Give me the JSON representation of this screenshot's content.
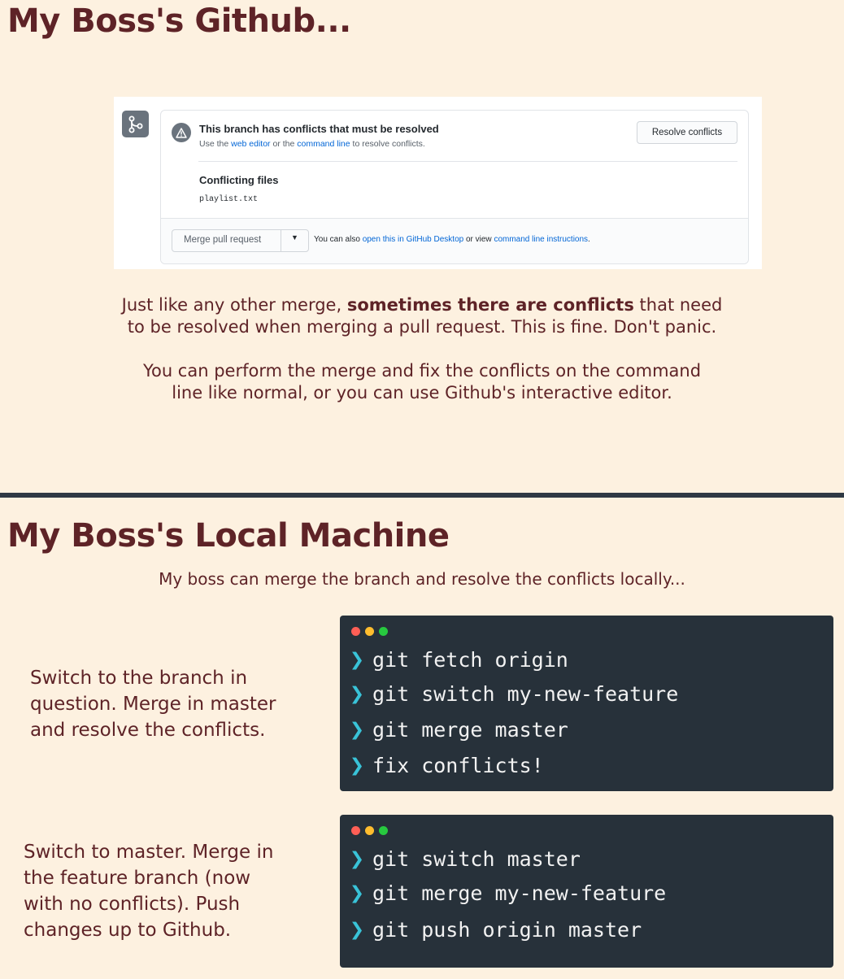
{
  "top_section": {
    "title": "My Boss's Github...",
    "github": {
      "conflict_title": "This branch has conflicts that must be resolved",
      "sub_use": "Use the ",
      "web_editor_link": "web editor",
      "sub_or": " or the ",
      "command_line_link": "command line",
      "sub_end": " to resolve conflicts.",
      "resolve_button": "Resolve conflicts",
      "conflicting_files_title": "Conflicting files",
      "files": [
        "playlist.txt"
      ],
      "merge_button": "Merge pull request",
      "footer_prefix": "You can also ",
      "desktop_link": "open this in GitHub Desktop",
      "footer_mid": " or view ",
      "instructions_link": "command line instructions",
      "footer_end": "."
    },
    "paragraph1": {
      "before": "Just like any other merge, ",
      "bold": "sometimes there are conflicts",
      "after": " that need",
      "line2": "to be resolved when merging a pull request. This is fine. Don't panic."
    },
    "paragraph2": {
      "line1": "You can perform the merge and fix the conflicts on the command",
      "line2": "line like normal, or you can use Github's interactive editor."
    }
  },
  "bottom_section": {
    "title": "My Boss's Local Machine",
    "subtitle": "My boss can merge the branch and resolve the conflicts locally...",
    "step1": {
      "lines": [
        "Switch to the branch in",
        "question.  Merge in master",
        "and resolve the conflicts."
      ],
      "commands": [
        "git fetch origin",
        "git switch my-new-feature",
        "git merge master",
        "fix conflicts!"
      ]
    },
    "step2": {
      "lines": [
        "Switch to master.  Merge in",
        "the feature branch (now",
        "with no conflicts).  Push",
        "changes up to Github."
      ],
      "commands": [
        "git switch master",
        "git merge my-new-feature",
        "git push origin master"
      ]
    },
    "prompt_symbol": "❯",
    "colors": {
      "background": "#fdf1e0",
      "text": "#5e2327",
      "terminal": "#27313a",
      "prompt": "#39c3d8"
    }
  }
}
